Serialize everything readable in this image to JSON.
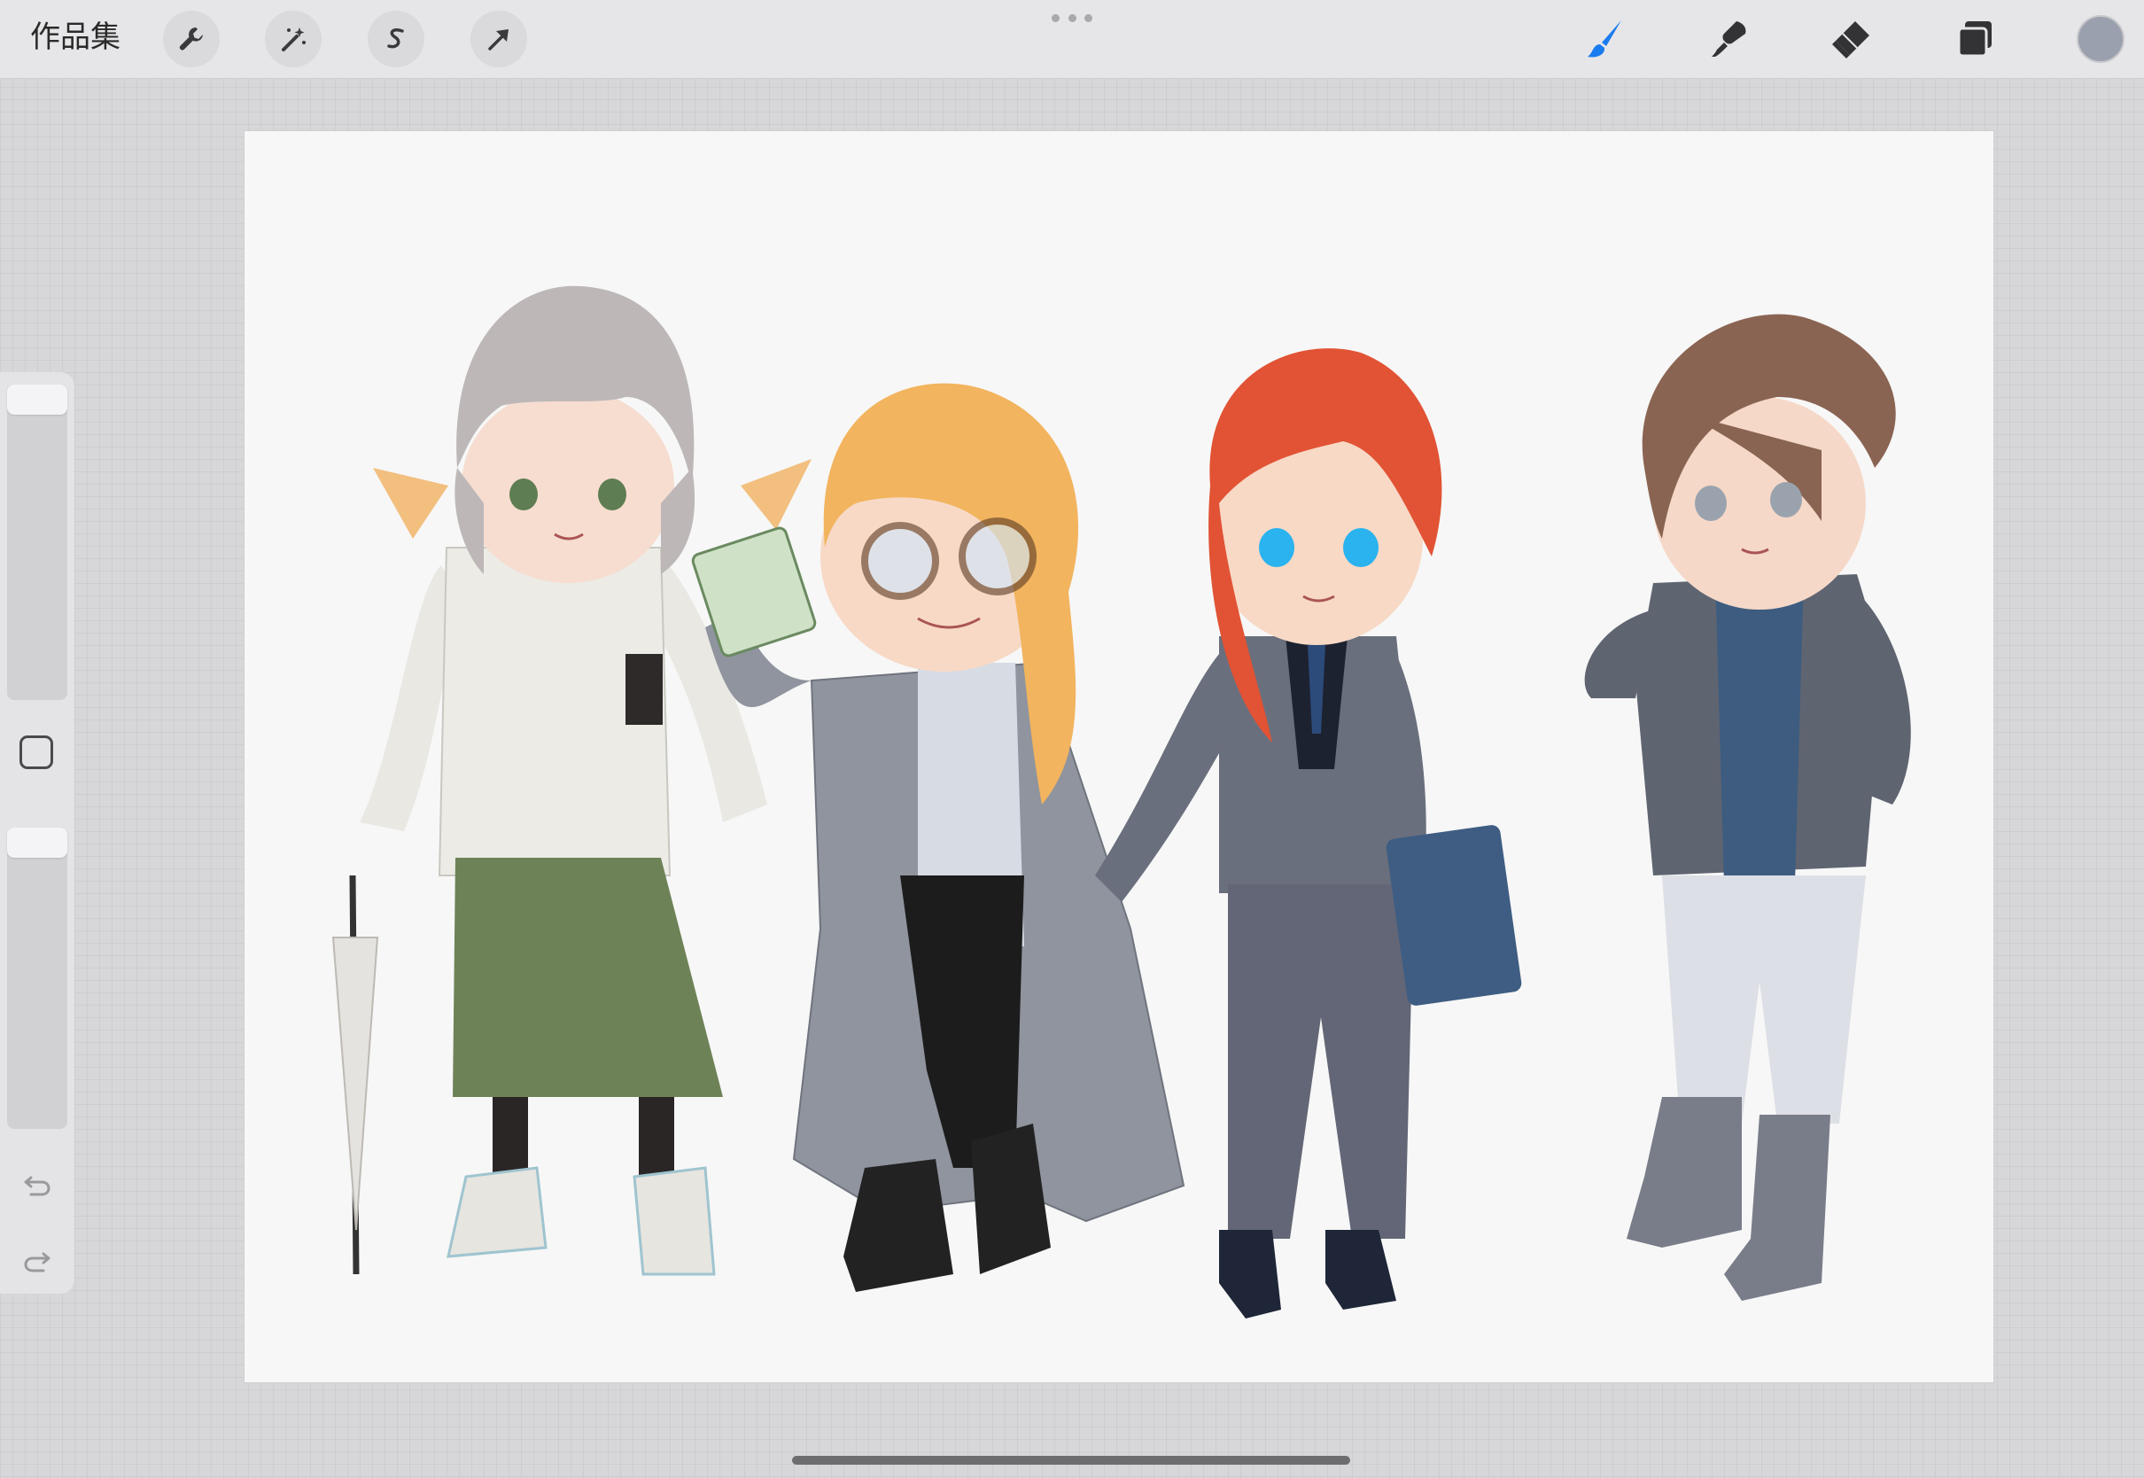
{
  "toolbar": {
    "gallery_label": "作品集",
    "left_tools": [
      "wrench-icon",
      "magic-wand-icon",
      "selection-icon",
      "transform-arrow-icon"
    ],
    "right_tools": [
      "brush-icon",
      "smudge-icon",
      "eraser-icon",
      "layers-icon"
    ],
    "active_tool": "brush",
    "accent_color": "#1b7cf0",
    "current_color": "#9aa0ad"
  },
  "sidebar": {
    "brush_size_level": 0.0,
    "opacity_level": 0.0,
    "controls": [
      "brush-size-slider",
      "modify-button",
      "opacity-slider",
      "undo-icon",
      "redo-icon"
    ]
  },
  "canvas": {
    "background_color": "#f7f7f7",
    "artwork": "chibi-characters-illustration"
  }
}
